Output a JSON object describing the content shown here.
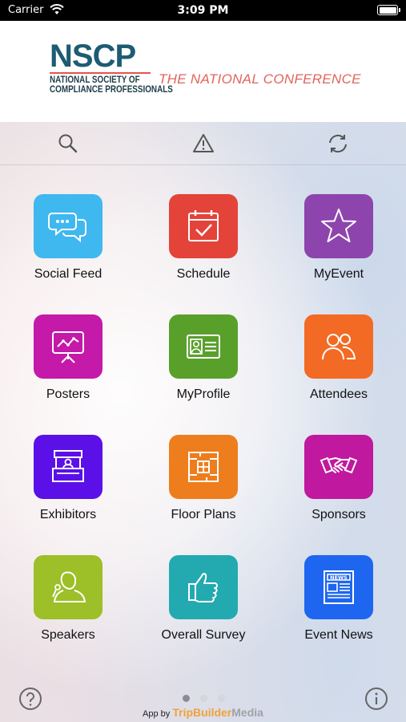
{
  "status_bar": {
    "carrier": "Carrier",
    "time": "3:09 PM"
  },
  "header": {
    "logo_main": "NSCP",
    "logo_line1": "NATIONAL SOCIETY OF",
    "logo_line2": "COMPLIANCE PROFESSIONALS",
    "tagline": "THE NATIONAL CONFERENCE"
  },
  "toolbar": {
    "icons": [
      "search-icon",
      "alert-icon",
      "refresh-icon"
    ]
  },
  "tiles": [
    {
      "label": "Social Feed",
      "icon": "chat-bubbles-icon",
      "color": "#3fb8f0"
    },
    {
      "label": "Schedule",
      "icon": "calendar-icon",
      "color": "#e4433a"
    },
    {
      "label": "MyEvent",
      "icon": "star-icon",
      "color": "#8e44ad"
    },
    {
      "label": "Posters",
      "icon": "presentation-icon",
      "color": "#c419a9"
    },
    {
      "label": "MyProfile",
      "icon": "id-card-icon",
      "color": "#59a02b"
    },
    {
      "label": "Attendees",
      "icon": "people-icon",
      "color": "#f26a24"
    },
    {
      "label": "Exhibitors",
      "icon": "booth-icon",
      "color": "#5b10e8"
    },
    {
      "label": "Floor Plans",
      "icon": "floor-plan-icon",
      "color": "#ee7d1d"
    },
    {
      "label": "Sponsors",
      "icon": "handshake-icon",
      "color": "#c0189e"
    },
    {
      "label": "Speakers",
      "icon": "speaker-icon",
      "color": "#9dbf28"
    },
    {
      "label": "Overall Survey",
      "icon": "thumbs-up-icon",
      "color": "#22aab0"
    },
    {
      "label": "Event News",
      "icon": "newspaper-icon",
      "color": "#1e66f0"
    }
  ],
  "pager": {
    "pages": 3,
    "current": 1
  },
  "footer": {
    "prefix": "App by",
    "brand_part1": "TripBuilder",
    "brand_part2": "Media"
  }
}
